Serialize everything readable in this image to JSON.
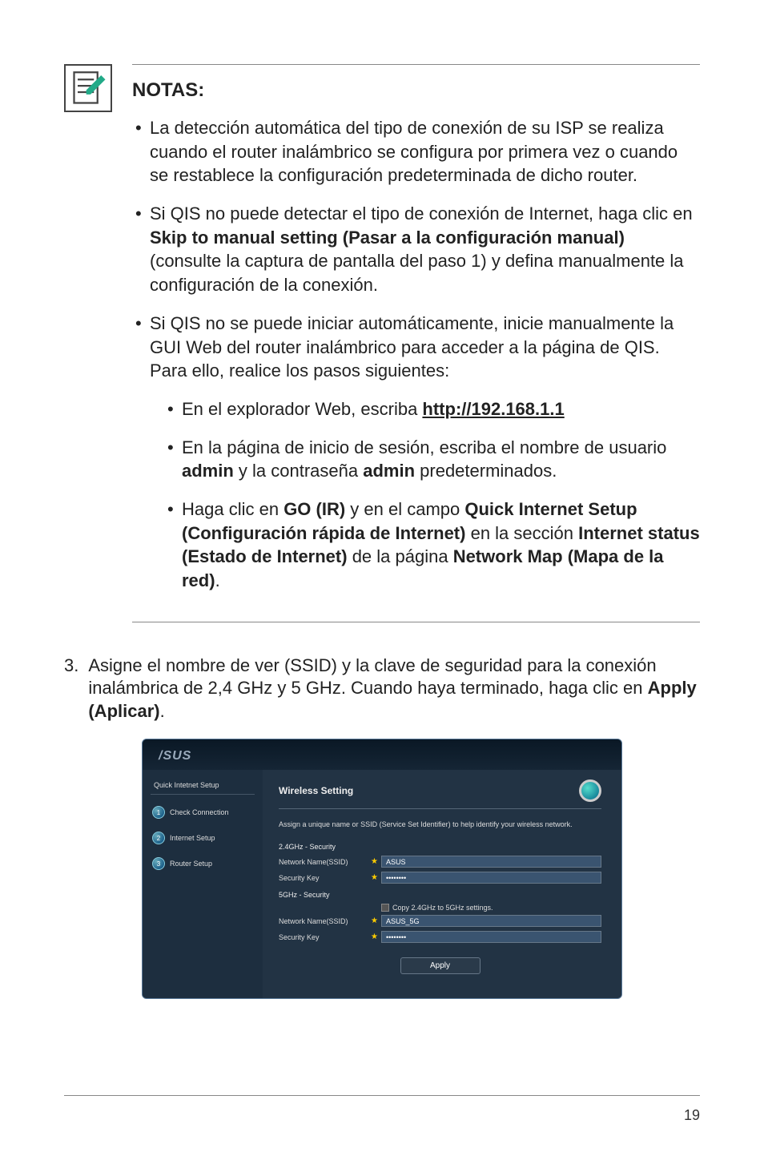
{
  "note_title": "NOTAS",
  "notes": {
    "n1": "La detección automática del tipo de conexión de su ISP se realiza cuando el router inalámbrico se configura por primera vez o cuando se restablece la configuración predeterminada de dicho router.",
    "n2_a": "Si QIS no puede detectar el tipo de conexión de Internet, haga clic en ",
    "n2_b": "Skip to manual setting (Pasar a la configuración manual)",
    "n2_c": " (consulte la captura de pantalla del paso 1) y defina manualmente la configuración de la conexión.",
    "n3": "Si QIS no se puede iniciar automáticamente, inicie manualmente la GUI Web del router inalámbrico para acceder a la página de QIS. Para ello, realice los pasos siguientes:",
    "s1_a": "En el explorador Web, escriba ",
    "s1_link": "http://192.168.1.1",
    "s2_a": "En la página de inicio de sesión, escriba el nombre de usuario ",
    "s2_b": "admin",
    "s2_c": " y la contraseña ",
    "s2_d": "admin",
    "s2_e": " predeterminados.",
    "s3_a": "Haga clic en ",
    "s3_b": "GO (IR)",
    "s3_c": " y en el campo ",
    "s3_d": "Quick Internet Setup (Configuración rápida de Internet)",
    "s3_e": " en la sección ",
    "s3_f": "Internet status (Estado de Internet)",
    "s3_g": " de la página ",
    "s3_h": "Network Map (Mapa de la red)",
    "s3_i": "."
  },
  "step3_num": "3.",
  "step3_a": "Asigne el nombre de ver (SSID) y la clave de seguridad para la conexión inalámbrica de 2,4 GHz y 5 GHz. Cuando haya terminado, haga clic en ",
  "step3_b": "Apply (Aplicar)",
  "step3_c": ".",
  "screenshot": {
    "logo": "/SUS",
    "side_title": "Quick Intetnet Setup",
    "step1": "Check Connection",
    "step2": "Internet Setup",
    "step3": "Router Setup",
    "n1": "1",
    "n2": "2",
    "n3": "3",
    "heading": "Wireless Setting",
    "desc": "Assign a unique name or SSID (Service Set Identifier) to help identify your wireless network.",
    "sec24": "2.4GHz - Security",
    "nnssid": "Network Name(SSID)",
    "seckey": "Security Key",
    "sec5": "5GHz - Security",
    "ssid24_val": "ASUS",
    "key24_val": "••••••••",
    "copy_label": "Copy 2.4GHz to 5GHz settings.",
    "ssid5_val": "ASUS_5G",
    "key5_val": "••••••••",
    "apply": "Apply"
  },
  "page_num": "19"
}
